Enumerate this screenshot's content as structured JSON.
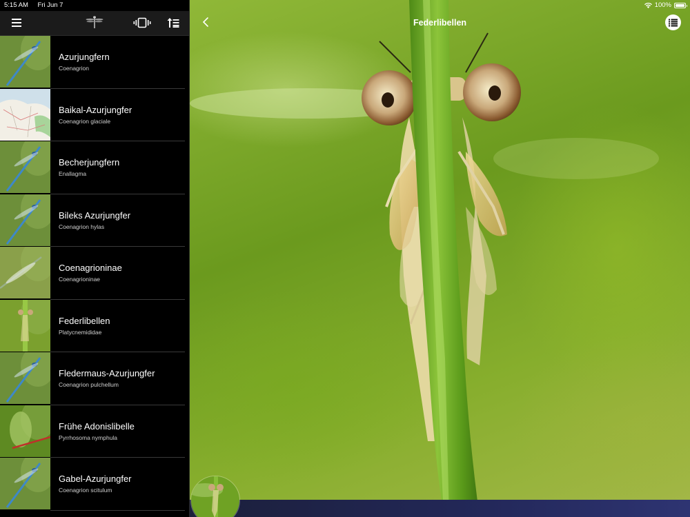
{
  "status": {
    "time": "5:15 AM",
    "date": "Fri Jun 7",
    "battery": "100%",
    "battery_level": 1.0
  },
  "header": {
    "title": "Federlibellen"
  },
  "icons": {
    "menu": "hamburger-icon",
    "logo": "dragonfly-icon",
    "vibrate": "vibrate-icon",
    "sort": "sort-icon",
    "back": "chevron-left-icon",
    "list": "list-icon",
    "wifi": "wifi-icon"
  },
  "species": [
    {
      "name": "Azurjungfern",
      "latin": "Coenagrion",
      "thumb": "blue-damselfly"
    },
    {
      "name": "Baikal-Azurjungfer",
      "latin": "Coenagrion glaciale",
      "thumb": "map"
    },
    {
      "name": "Becherjungfern",
      "latin": "Enallagma",
      "thumb": "blue-damselfly"
    },
    {
      "name": "Bileks Azurjungfer",
      "latin": "Coenagrion hylas",
      "thumb": "blue-damselfly"
    },
    {
      "name": "Coenagrioninae",
      "latin": "Coenagrioninae",
      "thumb": "green-damselfly"
    },
    {
      "name": "Federlibellen",
      "latin": "Platycnemididae",
      "thumb": "yellow-damselfly"
    },
    {
      "name": "Fledermaus-Azurjungfer",
      "latin": "Coenagrion pulchellum",
      "thumb": "blue-damselfly"
    },
    {
      "name": "Frühe Adonislibelle",
      "latin": "Pyrrhosoma nymphula",
      "thumb": "red-damselfly"
    },
    {
      "name": "Gabel-Azurjungfer",
      "latin": "Coenagrion scitulum",
      "thumb": "blue-damselfly"
    }
  ],
  "colors": {
    "sidebar_bg": "#000000",
    "toolbar_bg": "#1b1b1b",
    "photo_green": "#7fa82a",
    "bottom_bar": "#23285a"
  }
}
